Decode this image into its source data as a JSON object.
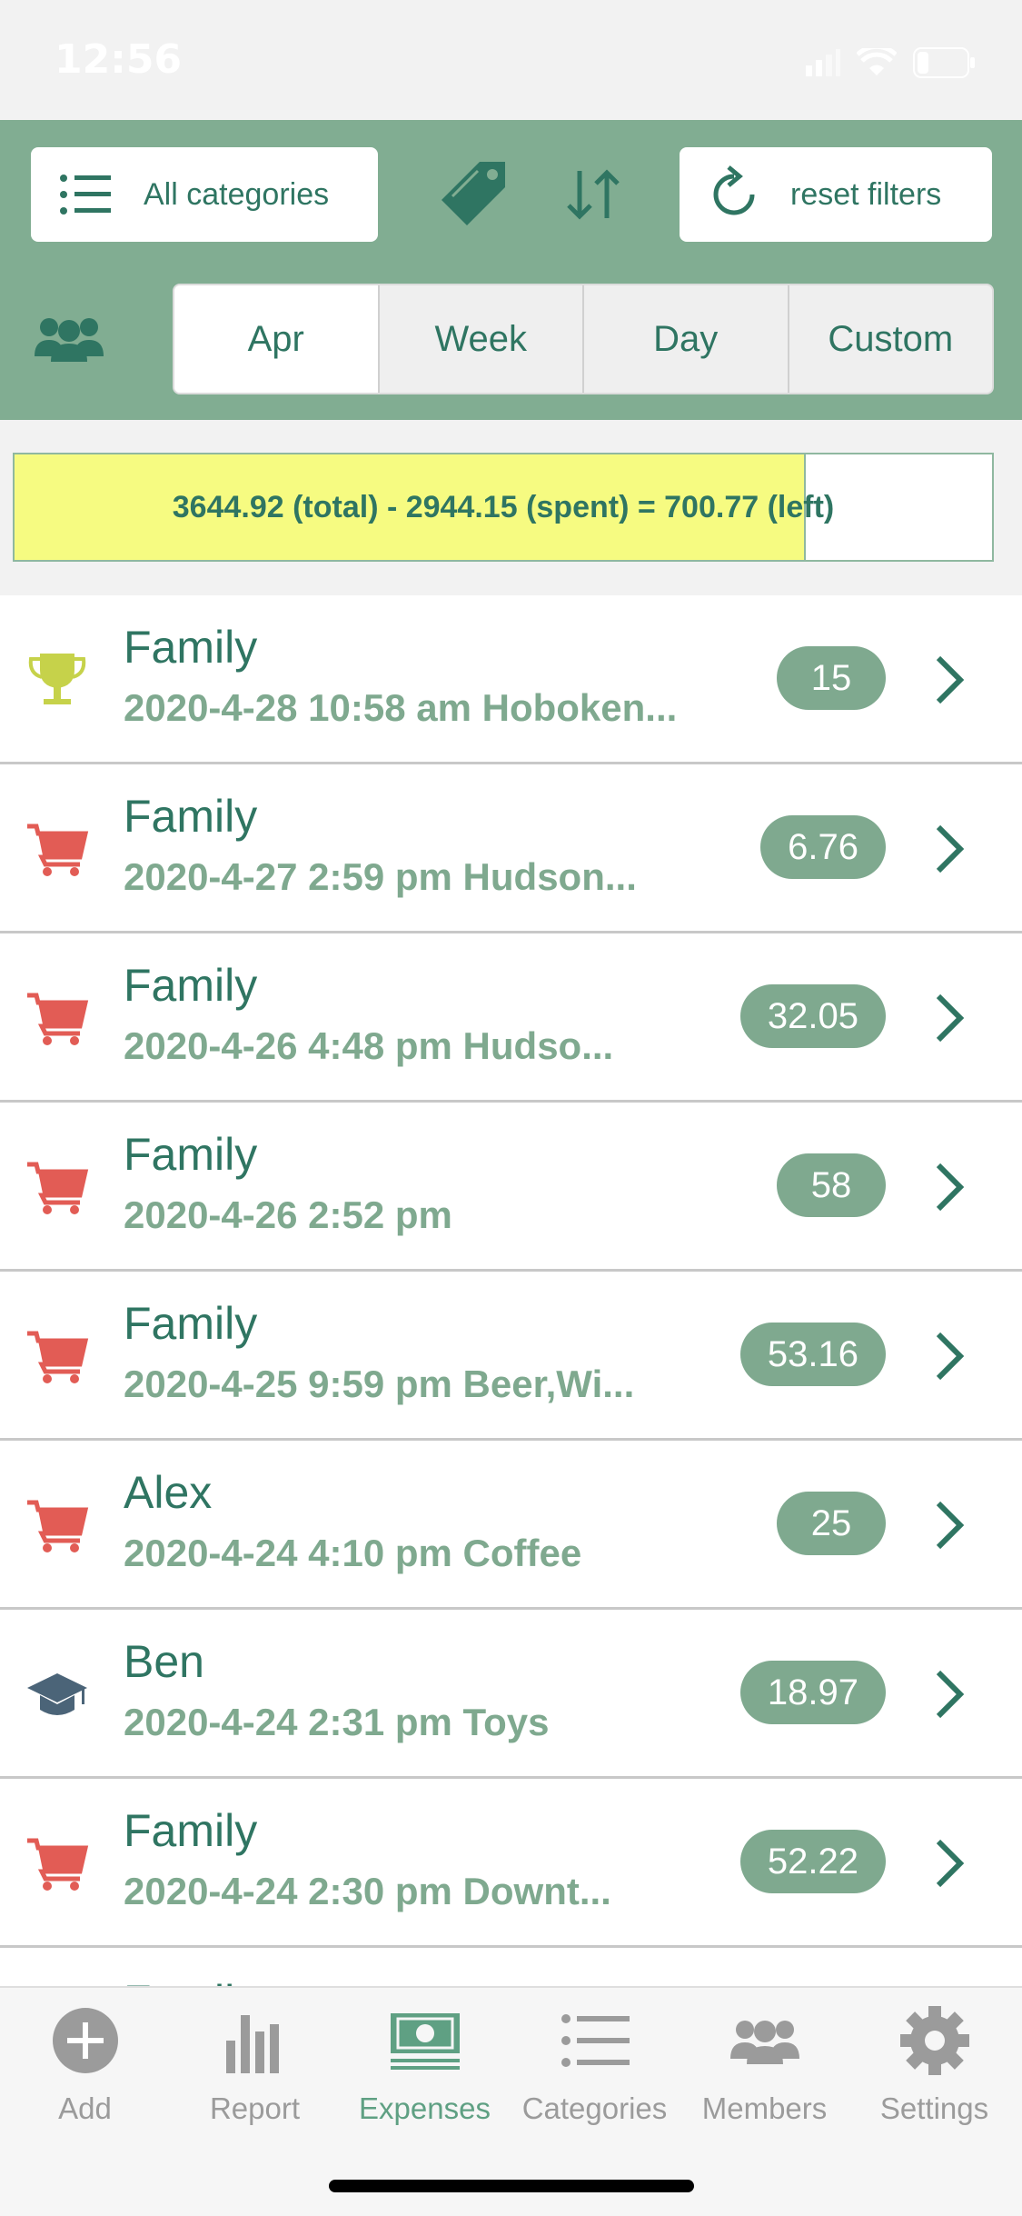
{
  "status": {
    "time": "12:56"
  },
  "toolbar": {
    "categories_label": "All categories",
    "reset_label": "reset filters",
    "periods": [
      "Apr",
      "Week",
      "Day",
      "Custom"
    ],
    "active_period": "Apr"
  },
  "budget": {
    "text": "3644.92 (total) - 2944.15 (spent) = 700.77 (left)",
    "total": 3644.92,
    "spent": 2944.15,
    "left": 700.77,
    "spent_fraction": 0.808
  },
  "expenses": [
    {
      "title": "Family",
      "subtitle": "2020-4-28 10:58 am Hoboken...",
      "amount": "15",
      "icon": "trophy-icon",
      "icon_color": "#c6d24a"
    },
    {
      "title": "Family",
      "subtitle": "2020-4-27 2:59 pm Hudson...",
      "amount": "6.76",
      "icon": "cart-icon",
      "icon_color": "#e25c55"
    },
    {
      "title": "Family",
      "subtitle": "2020-4-26 4:48 pm Hudso...",
      "amount": "32.05",
      "icon": "cart-icon",
      "icon_color": "#e25c55"
    },
    {
      "title": "Family",
      "subtitle": "2020-4-26 2:52 pm",
      "amount": "58",
      "icon": "cart-icon",
      "icon_color": "#e25c55"
    },
    {
      "title": "Family",
      "subtitle": "2020-4-25 9:59 pm Beer,Wi...",
      "amount": "53.16",
      "icon": "cart-icon",
      "icon_color": "#e25c55"
    },
    {
      "title": "Alex",
      "subtitle": "2020-4-24 4:10 pm Coffee",
      "amount": "25",
      "icon": "cart-icon",
      "icon_color": "#e25c55"
    },
    {
      "title": "Ben",
      "subtitle": "2020-4-24 2:31 pm Toys",
      "amount": "18.97",
      "icon": "graduation-cap-icon",
      "icon_color": "#4b6478"
    },
    {
      "title": "Family",
      "subtitle": "2020-4-24 2:30 pm Downt...",
      "amount": "52.22",
      "icon": "cart-icon",
      "icon_color": "#e25c55"
    }
  ],
  "partial_row": {
    "title": "Family"
  },
  "tabs": [
    {
      "label": "Add",
      "icon": "add-circle-icon"
    },
    {
      "label": "Report",
      "icon": "bar-chart-icon"
    },
    {
      "label": "Expenses",
      "icon": "money-icon",
      "active": true
    },
    {
      "label": "Categories",
      "icon": "list-icon"
    },
    {
      "label": "Members",
      "icon": "members-icon"
    },
    {
      "label": "Settings",
      "icon": "gear-icon"
    }
  ],
  "colors": {
    "accent": "#2f7562",
    "toolbar": "#81ad92",
    "badge": "#7fa98f",
    "budget_fill": "#f6fb81"
  }
}
